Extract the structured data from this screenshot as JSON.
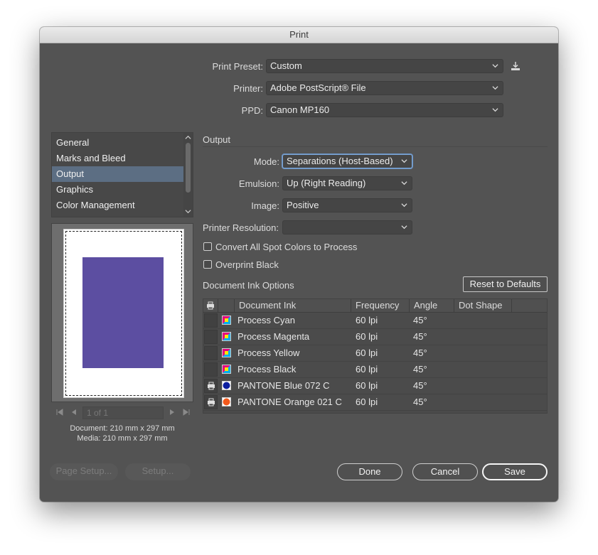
{
  "window": {
    "title": "Print"
  },
  "presets": {
    "print_preset": {
      "label": "Print Preset:",
      "value": "Custom"
    },
    "printer": {
      "label": "Printer:",
      "value": "Adobe PostScript® File"
    },
    "ppd": {
      "label": "PPD:",
      "value": "Canon MP160"
    }
  },
  "sidebar": {
    "items": [
      {
        "label": "General",
        "selected": false
      },
      {
        "label": "Marks and Bleed",
        "selected": false
      },
      {
        "label": "Output",
        "selected": true
      },
      {
        "label": "Graphics",
        "selected": false
      },
      {
        "label": "Color Management",
        "selected": false
      }
    ]
  },
  "preview": {
    "page_color": "#ffffff",
    "art_color": "#5c4ea1",
    "pager_text": "1 of 1",
    "document_size": "Document: 210 mm x 297 mm",
    "media_size": "Media: 210 mm x 297 mm"
  },
  "output": {
    "section_title": "Output",
    "mode": {
      "label": "Mode:",
      "value": "Separations (Host-Based)"
    },
    "emulsion": {
      "label": "Emulsion:",
      "value": "Up (Right Reading)"
    },
    "image": {
      "label": "Image:",
      "value": "Positive"
    },
    "printer_resolution": {
      "label": "Printer Resolution:",
      "value": ""
    },
    "convert_spot": {
      "label": "Convert All Spot Colors to Process",
      "checked": false
    },
    "overprint_black": {
      "label": "Overprint Black",
      "checked": false
    }
  },
  "ink_options": {
    "title": "Document Ink Options",
    "reset_label": "Reset to Defaults",
    "columns": [
      "Document Ink",
      "Frequency",
      "Angle",
      "Dot Shape"
    ],
    "rows": [
      {
        "print": false,
        "swatch": "process",
        "ink": "Process Cyan",
        "frequency": "60 lpi",
        "angle": "45°",
        "dot_shape": ""
      },
      {
        "print": false,
        "swatch": "process",
        "ink": "Process Magenta",
        "frequency": "60 lpi",
        "angle": "45°",
        "dot_shape": ""
      },
      {
        "print": false,
        "swatch": "process",
        "ink": "Process Yellow",
        "frequency": "60 lpi",
        "angle": "45°",
        "dot_shape": ""
      },
      {
        "print": false,
        "swatch": "process",
        "ink": "Process Black",
        "frequency": "60 lpi",
        "angle": "45°",
        "dot_shape": ""
      },
      {
        "print": true,
        "swatch": "#0c1ea0",
        "ink": "PANTONE Blue 072 C",
        "frequency": "60 lpi",
        "angle": "45°",
        "dot_shape": ""
      },
      {
        "print": true,
        "swatch": "#f2591c",
        "ink": "PANTONE Orange 021 C",
        "frequency": "60 lpi",
        "angle": "45°",
        "dot_shape": ""
      }
    ]
  },
  "footer": {
    "page_setup": "Page Setup...",
    "setup": "Setup...",
    "done": "Done",
    "cancel": "Cancel",
    "save": "Save"
  },
  "icons": {
    "save_preset": "download-icon",
    "print_toggle": "printer-icon",
    "dropdown": "chevron-down-icon"
  }
}
